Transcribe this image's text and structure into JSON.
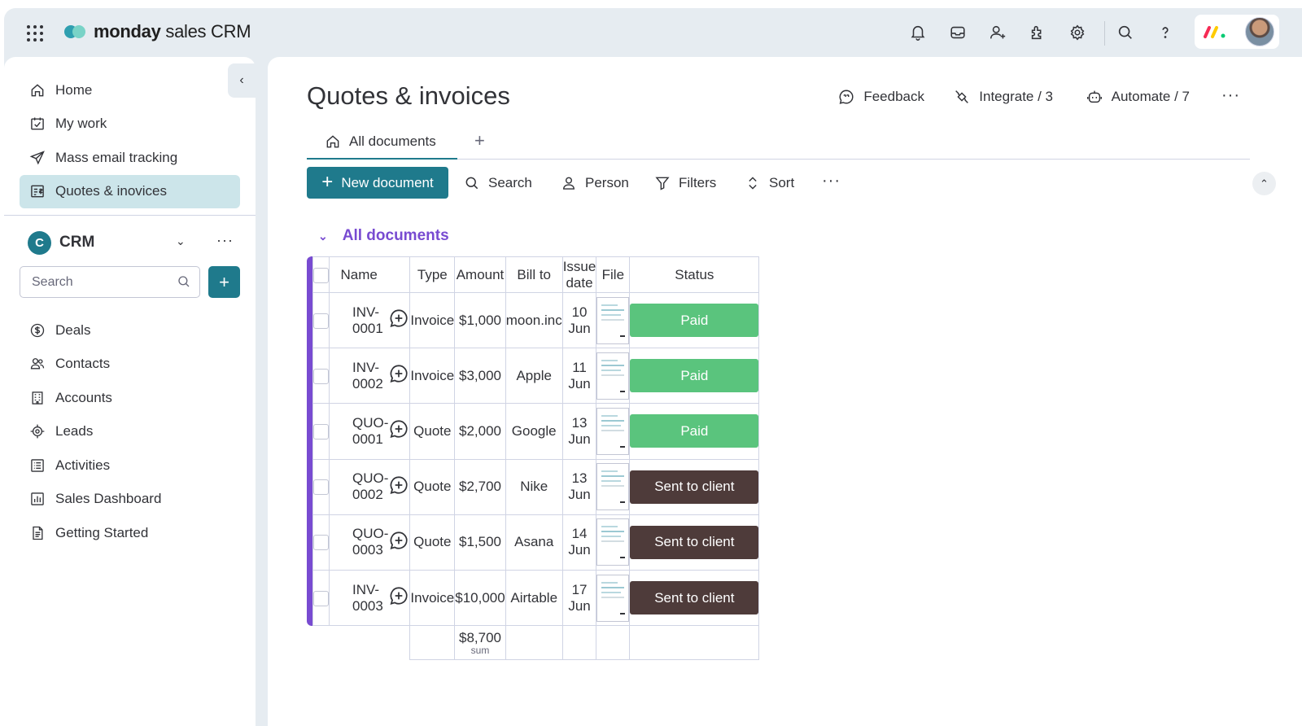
{
  "app": {
    "brand_bold": "monday",
    "brand_rest": " sales CRM"
  },
  "topbar_icons": [
    "bell-icon",
    "inbox-icon",
    "invite-icon",
    "integrations-icon",
    "settings-icon",
    "search-icon",
    "help-icon"
  ],
  "sidebar": {
    "items": [
      {
        "label": "Home",
        "icon": "home-icon"
      },
      {
        "label": "My work",
        "icon": "my-work-icon"
      },
      {
        "label": "Mass email tracking",
        "icon": "paper-plane-icon"
      },
      {
        "label": "Quotes & inovices",
        "icon": "quote-icon",
        "active": true
      }
    ],
    "workspace": {
      "badge": "C",
      "name": "CRM"
    },
    "search_placeholder": "Search",
    "add_label": "+",
    "boards": [
      {
        "label": "Deals",
        "icon": "dollar-icon"
      },
      {
        "label": "Contacts",
        "icon": "contacts-icon"
      },
      {
        "label": "Accounts",
        "icon": "building-icon"
      },
      {
        "label": "Leads",
        "icon": "target-icon"
      },
      {
        "label": "Activities",
        "icon": "list-icon"
      },
      {
        "label": "Sales Dashboard",
        "icon": "chart-icon"
      },
      {
        "label": "Getting Started",
        "icon": "doc-icon"
      }
    ]
  },
  "main": {
    "title": "Quotes & invoices",
    "actions": {
      "feedback": "Feedback",
      "integrate": "Integrate / 3",
      "automate": "Automate / 7"
    },
    "tab": "All documents",
    "tab_add": "+",
    "toolbar": {
      "new_document": "New document",
      "search": "Search",
      "person": "Person",
      "filters": "Filters",
      "sort": "Sort"
    },
    "group_title": "All documents"
  },
  "table": {
    "columns": {
      "name": "Name",
      "type": "Type",
      "amount": "Amount",
      "bill_to": "Bill to",
      "issue_date": "Issue date",
      "file": "File",
      "status": "Status"
    },
    "rows": [
      {
        "name": "INV-0001",
        "type": "Invoice",
        "amount": "$1,000",
        "bill_to": "moon.inc",
        "issue_date": "10 Jun",
        "status": "Paid",
        "status_color": "#5ac47d"
      },
      {
        "name": "INV-0002",
        "type": "Invoice",
        "amount": "$3,000",
        "bill_to": "Apple",
        "issue_date": "11 Jun",
        "status": "Paid",
        "status_color": "#5ac47d"
      },
      {
        "name": "QUO-0001",
        "type": "Quote",
        "amount": "$2,000",
        "bill_to": "Google",
        "issue_date": "13 Jun",
        "status": "Paid",
        "status_color": "#5ac47d"
      },
      {
        "name": "QUO-0002",
        "type": "Quote",
        "amount": "$2,700",
        "bill_to": "Nike",
        "issue_date": "13 Jun",
        "status": "Sent to client",
        "status_color": "#4e3b3a"
      },
      {
        "name": "QUO-0003",
        "type": "Quote",
        "amount": "$1,500",
        "bill_to": "Asana",
        "issue_date": "14 Jun",
        "status": "Sent to client",
        "status_color": "#4e3b3a"
      },
      {
        "name": "INV-0003",
        "type": "Invoice",
        "amount": "$10,000",
        "bill_to": "Airtable",
        "issue_date": "17 Jun",
        "status": "Sent to client",
        "status_color": "#4e3b3a"
      }
    ],
    "summary": {
      "value": "$8,700",
      "label": "sum"
    }
  },
  "colors": {
    "accent": "#1f7a8c",
    "group": "#784bd1",
    "paid": "#5ac47d",
    "sent": "#4e3b3a"
  }
}
